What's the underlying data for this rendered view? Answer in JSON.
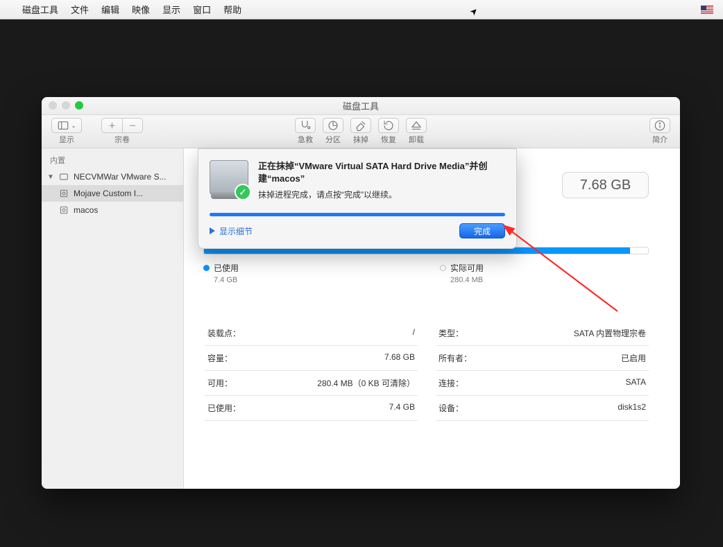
{
  "menubar": {
    "items": [
      "磁盘工具",
      "文件",
      "编辑",
      "映像",
      "显示",
      "窗口",
      "帮助"
    ]
  },
  "window": {
    "title": "磁盘工具",
    "toolbar": {
      "view": "显示",
      "volume": "宗卷",
      "firstaid": "急救",
      "partition": "分区",
      "erase": "抹掉",
      "restore": "恢复",
      "unmount": "卸载",
      "info": "简介"
    },
    "sidebar": {
      "header": "内置",
      "items": [
        {
          "label": "NECVMWar VMware S..."
        },
        {
          "label": "Mojave Custom I..."
        },
        {
          "label": "macos"
        }
      ]
    },
    "capacity": "7.68 GB",
    "usage": {
      "used_label": "已使用",
      "used_value": "7.4 GB",
      "free_label": "实际可用",
      "free_value": "280.4 MB"
    },
    "info_left": [
      {
        "k": "装载点：",
        "v": "/"
      },
      {
        "k": "容量：",
        "v": "7.68 GB"
      },
      {
        "k": "可用：",
        "v": "280.4 MB（0 KB 可清除）"
      },
      {
        "k": "已使用：",
        "v": "7.4 GB"
      }
    ],
    "info_right": [
      {
        "k": "类型：",
        "v": "SATA 内置物理宗卷"
      },
      {
        "k": "所有者：",
        "v": "已启用"
      },
      {
        "k": "连接：",
        "v": "SATA"
      },
      {
        "k": "设备：",
        "v": "disk1s2"
      }
    ]
  },
  "dialog": {
    "title": "正在抹掉“VMware Virtual SATA Hard Drive Media”并创建“macos”",
    "message": "抹掉进程完成，请点按“完成”以继续。",
    "details_label": "显示细节",
    "done_label": "完成"
  },
  "colors": {
    "accent": "#1e79ff",
    "used": "#0a95ff"
  }
}
